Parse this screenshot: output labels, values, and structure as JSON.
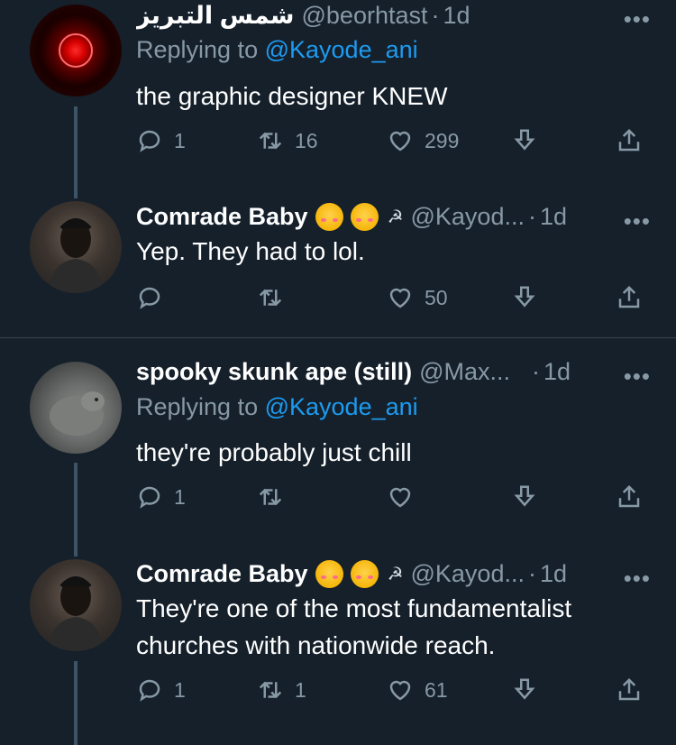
{
  "tweets": [
    {
      "name": "شمس التبريز",
      "handle": "@beorhtast",
      "time": "1d",
      "replying_prefix": "Replying to",
      "replying_to": "@Kayode_ani",
      "text": "the graphic designer KNEW",
      "replies": "1",
      "retweets": "16",
      "likes": "299"
    },
    {
      "name": "Comrade Baby",
      "symbol": "☭",
      "handle": "@Kayod...",
      "time": "1d",
      "text": "Yep. They had to lol.",
      "replies": "",
      "retweets": "",
      "likes": "50"
    },
    {
      "name": "spooky skunk ape (still)",
      "handle": "@Max...",
      "time": "1d",
      "replying_prefix": "Replying to",
      "replying_to": "@Kayode_ani",
      "text": "they're probably just chill",
      "replies": "1",
      "retweets": "",
      "likes": ""
    },
    {
      "name": "Comrade Baby",
      "symbol": "☭",
      "handle": "@Kayod...",
      "time": "1d",
      "text": "They're one of the most fundamentalist churches with nationwide reach.",
      "replies": "1",
      "retweets": "1",
      "likes": "61"
    }
  ],
  "dot": "·",
  "more": "•••",
  "icons": [
    "reply-icon",
    "retweet-icon",
    "like-icon",
    "download-icon",
    "share-icon"
  ],
  "colors": {
    "background": "#15202b",
    "secondary_text": "#8899a6",
    "mention": "#1d9bf0",
    "thread_line": "#3d5466"
  }
}
